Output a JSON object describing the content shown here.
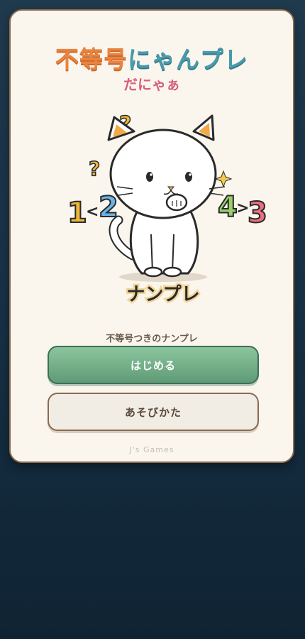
{
  "app": {
    "title_part1": "不等号",
    "title_part2": "にゃんプレ",
    "subtitle": "だにゃぁ",
    "hero": {
      "left_numbers": [
        "1",
        "<",
        "2"
      ],
      "right_numbers": [
        "4",
        ">",
        "3"
      ],
      "marks": [
        "?",
        "?"
      ],
      "badge_text": "ナンプレ"
    },
    "tagline": "不等号つきのナンプレ",
    "start_label": "はじめる",
    "howto_label": "あそびかた",
    "footer": "J's Games"
  },
  "colors": {
    "title_orange": "#e9843f",
    "title_teal": "#4a9aab",
    "subtitle_pink": "#d8607a",
    "start_green": "#6fa985",
    "card_bg": "#faf6ee",
    "card_border": "#8b6a4e",
    "page_bg": "#173246"
  }
}
